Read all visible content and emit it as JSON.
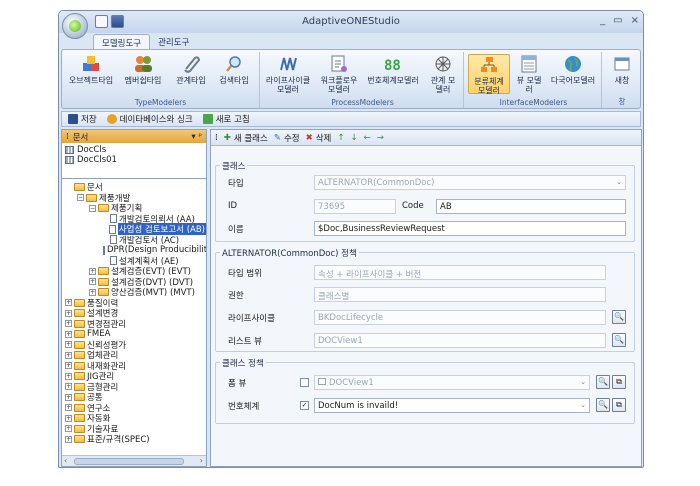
{
  "window": {
    "title": "AdaptiveONEStudio",
    "controls": [
      "_",
      "▭",
      "×"
    ]
  },
  "ribbon_tabs": [
    "모델링도구",
    "관리도구"
  ],
  "ribbon_groups": [
    {
      "label": "TypeModelers",
      "buttons": [
        "오브젝트타입",
        "멤버쉽타입",
        "관계타입",
        "검색타입"
      ]
    },
    {
      "label": "ProcessModelers",
      "buttons": [
        "라이프사이클\n모델러",
        "워크플로우\n모델러",
        "번호체계모델러",
        "관계 모\n델러"
      ]
    },
    {
      "label": "InterfaceModelers",
      "buttons": [
        "분류체계\n모델러",
        "뷰 모델\n러",
        "다국어모델러"
      ]
    },
    {
      "label": "창",
      "buttons": [
        "새창"
      ]
    }
  ],
  "toolbar": {
    "save": "저장",
    "sync": "데이타베이스와 싱크",
    "refresh": "새로 고침"
  },
  "left_panel": {
    "header": "문서",
    "pin": "▾ ᵖ",
    "doc_classes": [
      "DocCls",
      "DocCls01"
    ],
    "tree": [
      {
        "level": 0,
        "label": "문서",
        "exp": "",
        "kind": "folder"
      },
      {
        "level": 1,
        "label": "제품개발",
        "exp": "−",
        "kind": "folder"
      },
      {
        "level": 2,
        "label": "제품기획",
        "exp": "−",
        "kind": "folder"
      },
      {
        "level": 3,
        "label": "개발검토의뢰서 (AA)",
        "exp": "",
        "kind": "doc"
      },
      {
        "level": 3,
        "label": "사업성 검토보고서 (AB)",
        "exp": "",
        "kind": "doc",
        "selected": true
      },
      {
        "level": 3,
        "label": "개발검토서 (AC)",
        "exp": "",
        "kind": "doc"
      },
      {
        "level": 3,
        "label": "DPR(Design Producibility)",
        "exp": "",
        "kind": "doc"
      },
      {
        "level": 3,
        "label": "설계계획서 (AE)",
        "exp": "",
        "kind": "doc"
      },
      {
        "level": 2,
        "label": "설계검증(EVT) (EVT)",
        "exp": "+",
        "kind": "folder"
      },
      {
        "level": 2,
        "label": "설계검증(DVT) (DVT)",
        "exp": "+",
        "kind": "folder"
      },
      {
        "level": 2,
        "label": "양산검증(MVT) (MVT)",
        "exp": "+",
        "kind": "folder"
      },
      {
        "level": 0,
        "label": "품질이력",
        "exp": "+",
        "kind": "folder"
      },
      {
        "level": 0,
        "label": "설계변경",
        "exp": "+",
        "kind": "folder"
      },
      {
        "level": 0,
        "label": "변경점관리",
        "exp": "+",
        "kind": "folder"
      },
      {
        "level": 0,
        "label": "FMEA",
        "exp": "+",
        "kind": "folder"
      },
      {
        "level": 0,
        "label": "신뢰성평가",
        "exp": "+",
        "kind": "folder"
      },
      {
        "level": 0,
        "label": "업체관리",
        "exp": "+",
        "kind": "folder"
      },
      {
        "level": 0,
        "label": "내재화관리",
        "exp": "+",
        "kind": "folder"
      },
      {
        "level": 0,
        "label": "JIG관리",
        "exp": "+",
        "kind": "folder"
      },
      {
        "level": 0,
        "label": "금형관리",
        "exp": "+",
        "kind": "folder"
      },
      {
        "level": 0,
        "label": "공통",
        "exp": "+",
        "kind": "folder"
      },
      {
        "level": 0,
        "label": "연구소",
        "exp": "+",
        "kind": "folder"
      },
      {
        "level": 0,
        "label": "자동화",
        "exp": "+",
        "kind": "folder"
      },
      {
        "level": 0,
        "label": "기술자료",
        "exp": "+",
        "kind": "folder"
      },
      {
        "level": 0,
        "label": "표준/규격(SPEC)",
        "exp": "+",
        "kind": "folder"
      }
    ]
  },
  "right_toolbar": {
    "new_class": "새 클래스",
    "edit": "수정",
    "delete": "삭제"
  },
  "class_group": {
    "legend": "클래스",
    "type_label": "타입",
    "type_value": "ALTERNATOR(CommonDoc)",
    "id_label": "ID",
    "id_value": "73695",
    "code_label": "Code",
    "code_value": "AB",
    "name_label": "이름",
    "name_value": "$Doc,BusinessReviewRequest"
  },
  "policy_group": {
    "legend": "ALTERNATOR(CommonDoc) 정책",
    "type_range_label": "타입 범위",
    "type_range_value": "속성 + 라이프사이클 + 버전",
    "perm_label": "권한",
    "perm_value": "클래스별",
    "lifecycle_label": "라이프사이클",
    "lifecycle_value": "BKDocLifecycle",
    "listview_label": "리스트 뷰",
    "listview_value": "DOCView1"
  },
  "class_policy_group": {
    "legend": "클래스 정책",
    "formview_label": "폼 뷰",
    "formview_value": "DOCView1",
    "formview_checked": false,
    "numbering_label": "번호체계",
    "numbering_value": "DocNum is invaild!",
    "numbering_checked": true
  }
}
